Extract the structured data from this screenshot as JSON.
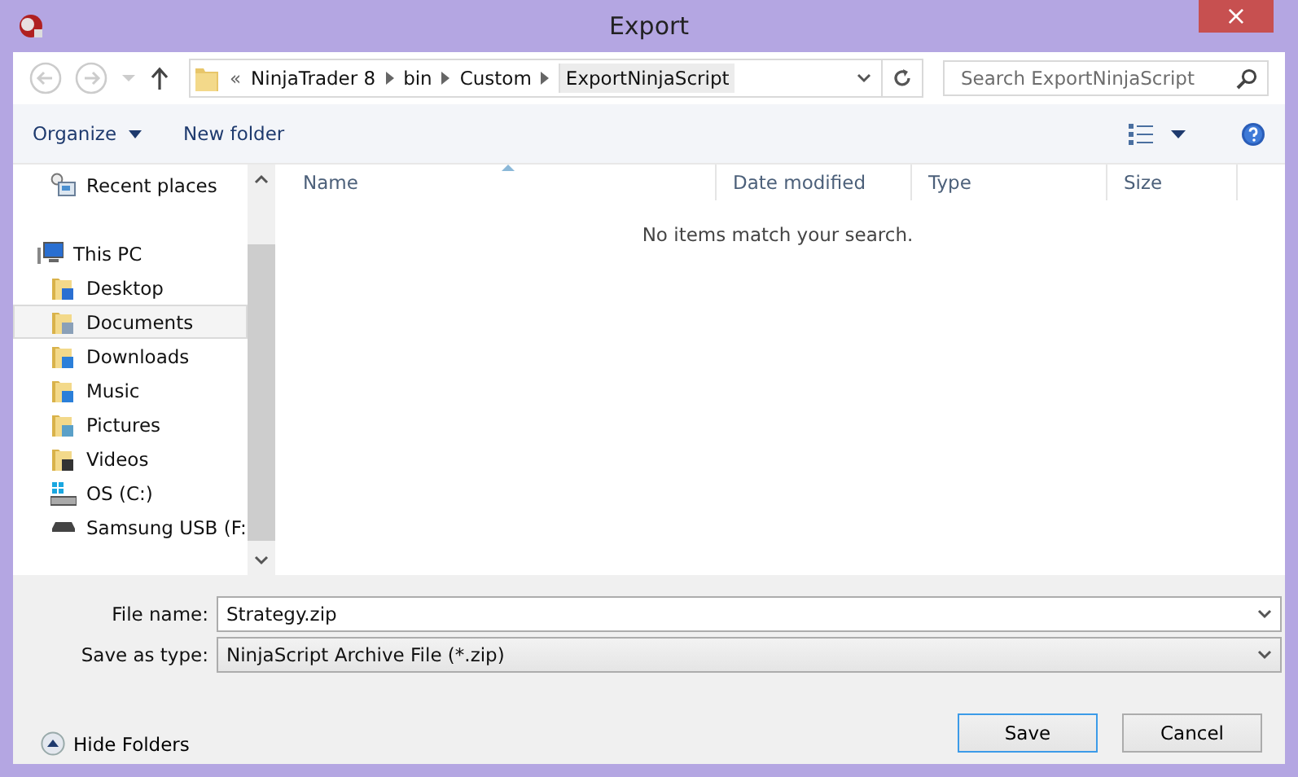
{
  "window": {
    "title": "Export",
    "close": "×"
  },
  "address": {
    "overflow": "«",
    "segments": [
      {
        "label": "NinjaTrader 8",
        "selected": false
      },
      {
        "label": "bin",
        "selected": false
      },
      {
        "label": "Custom",
        "selected": false
      },
      {
        "label": "ExportNinjaScript",
        "selected": true
      }
    ]
  },
  "search": {
    "placeholder": "Search ExportNinjaScript"
  },
  "toolbar": {
    "organize": "Organize",
    "new_folder": "New folder"
  },
  "sidebar": {
    "items": [
      {
        "label": "Recent places",
        "kind": "recent",
        "selected": false
      },
      {
        "label": "This PC",
        "kind": "pc",
        "selected": false,
        "children": [
          {
            "label": "Desktop",
            "kind": "desktop",
            "selected": false
          },
          {
            "label": "Documents",
            "kind": "documents",
            "selected": true
          },
          {
            "label": "Downloads",
            "kind": "downloads",
            "selected": false
          },
          {
            "label": "Music",
            "kind": "music",
            "selected": false
          },
          {
            "label": "Pictures",
            "kind": "pictures",
            "selected": false
          },
          {
            "label": "Videos",
            "kind": "videos",
            "selected": false
          },
          {
            "label": "OS (C:)",
            "kind": "disk",
            "selected": false
          },
          {
            "label": "Samsung USB (F:",
            "kind": "usb",
            "selected": false
          }
        ]
      }
    ]
  },
  "table": {
    "columns": [
      {
        "label": "Name",
        "sorted": true
      },
      {
        "label": "Date modified",
        "sorted": false
      },
      {
        "label": "Type",
        "sorted": false
      },
      {
        "label": "Size",
        "sorted": false
      }
    ],
    "empty_message": "No items match your search."
  },
  "form": {
    "file_name_label": "File name:",
    "file_name": "Strategy.zip",
    "type_label": "Save as type:",
    "type": "NinjaScript Archive File (*.zip)"
  },
  "hide_folders": "Hide Folders",
  "buttons": [
    {
      "label": "Save",
      "kind": "default"
    },
    {
      "label": "Cancel",
      "kind": "normal"
    }
  ]
}
